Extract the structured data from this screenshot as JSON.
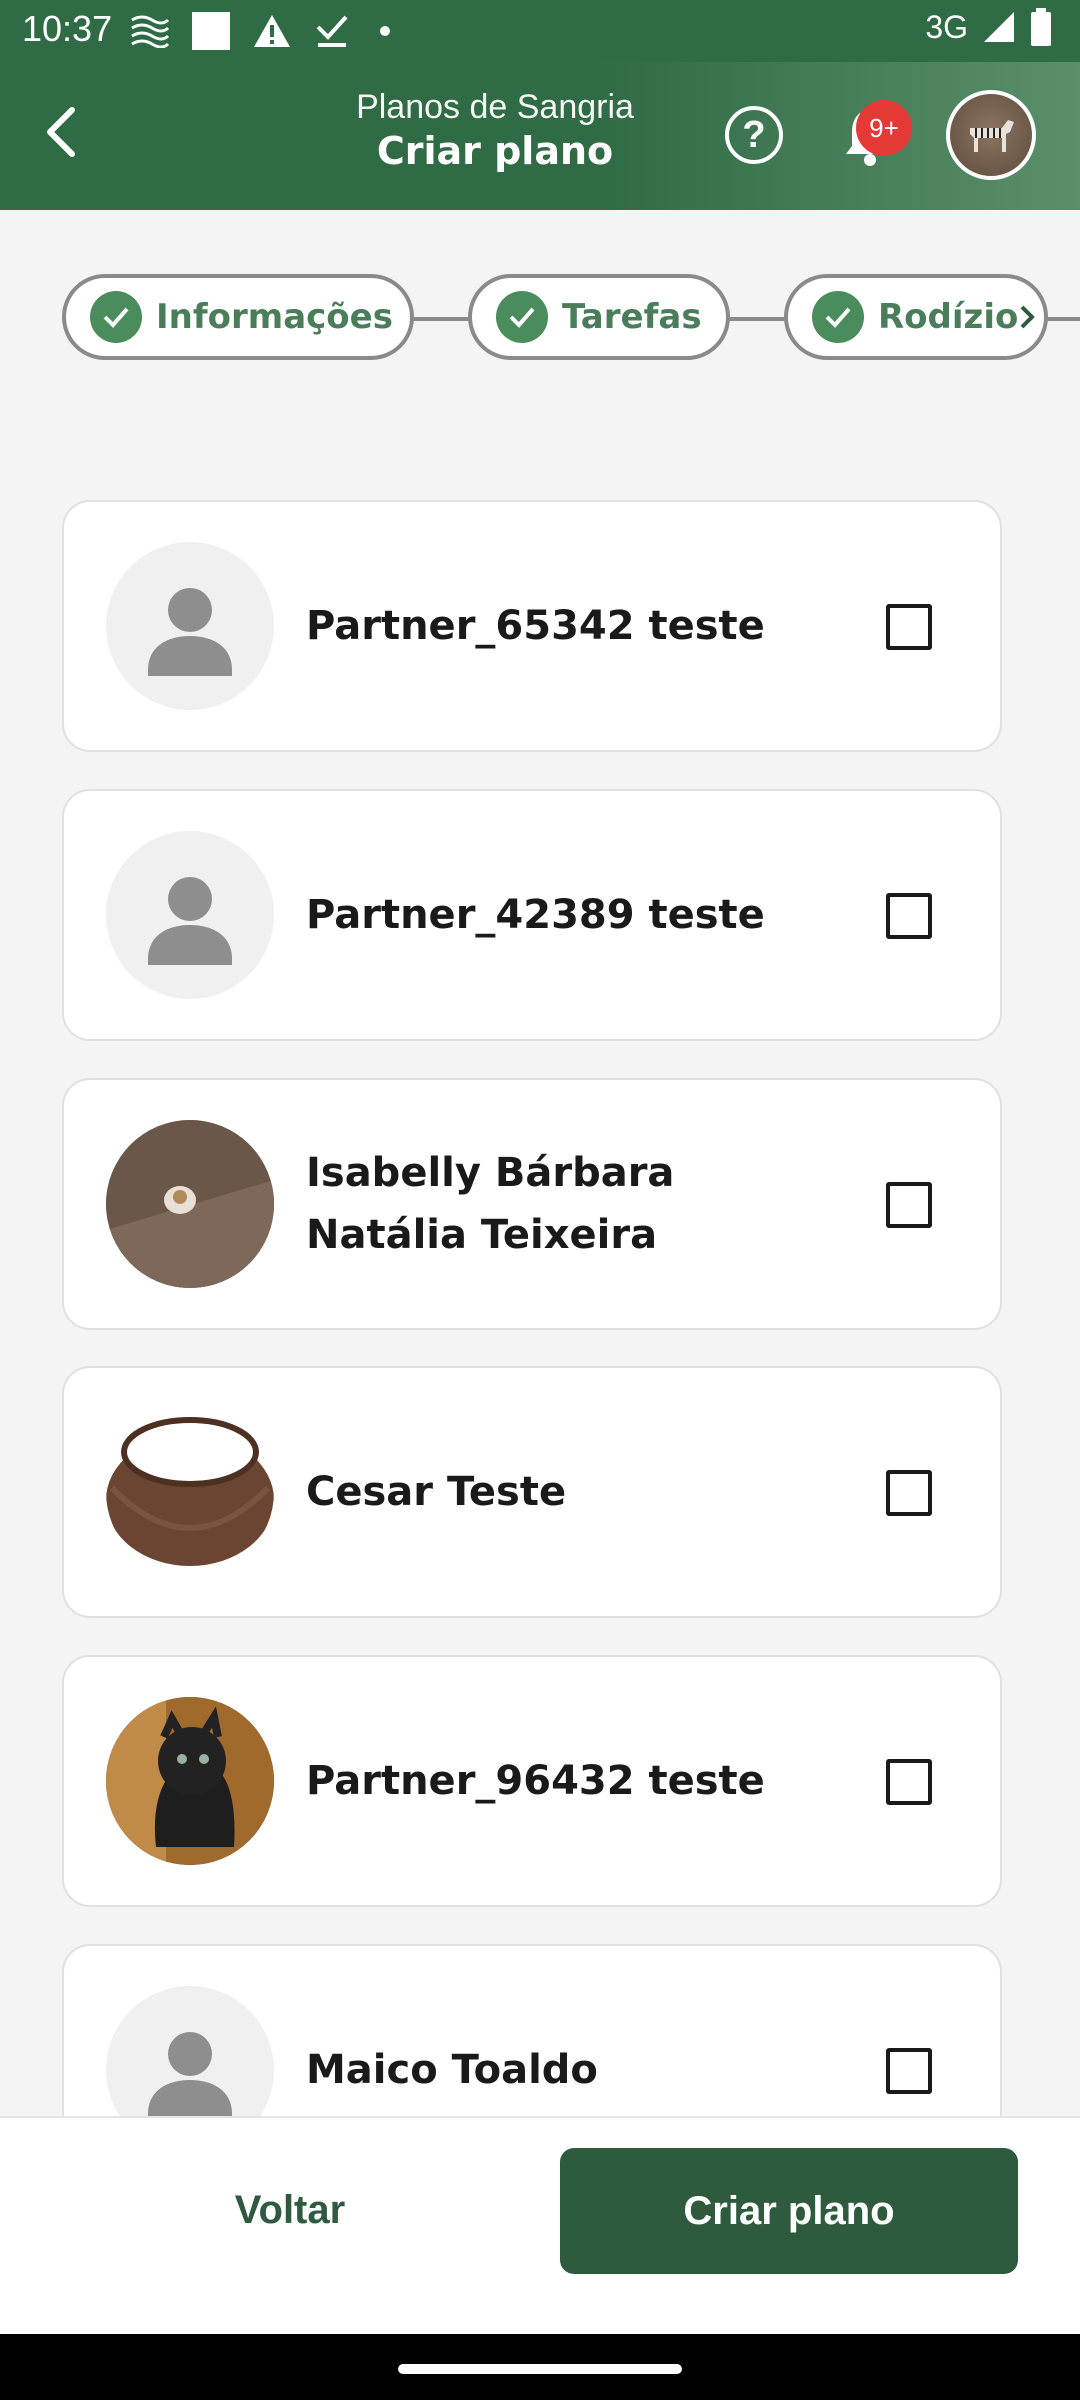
{
  "status_bar": {
    "time": "10:37",
    "network": "3G",
    "icons": [
      "wave-icon",
      "square-icon",
      "warning-icon",
      "download-done-icon",
      "dot-icon",
      "signal-icon",
      "battery-icon"
    ]
  },
  "header": {
    "subtitle": "Planos de Sangria",
    "title": "Criar plano",
    "notification_badge": "9+",
    "help_symbol": "?"
  },
  "stepper": {
    "steps": [
      {
        "label": "Informações",
        "completed": true
      },
      {
        "label": "Tarefas",
        "completed": true
      },
      {
        "label": "Rodízio",
        "completed": true
      }
    ]
  },
  "partners": [
    {
      "name": "Partner_65342 teste",
      "avatar": "default",
      "checked": false
    },
    {
      "name": "Partner_42389 teste",
      "avatar": "default",
      "checked": false
    },
    {
      "name": "Isabelly Bárbara Natália Teixeira",
      "avatar": "photo-coffee",
      "checked": false
    },
    {
      "name": "Cesar Teste",
      "avatar": "photo-wood-ring",
      "checked": false
    },
    {
      "name": "Partner_96432 teste",
      "avatar": "photo-dragon",
      "checked": false
    },
    {
      "name": "Maico Toaldo",
      "avatar": "default",
      "checked": false
    }
  ],
  "actions": {
    "back_label": "Voltar",
    "create_label": "Criar plano"
  },
  "colors": {
    "primary": "#2f6b45",
    "button": "#2e5a3e",
    "step_check": "#4a8c5c",
    "badge": "#e53935"
  }
}
